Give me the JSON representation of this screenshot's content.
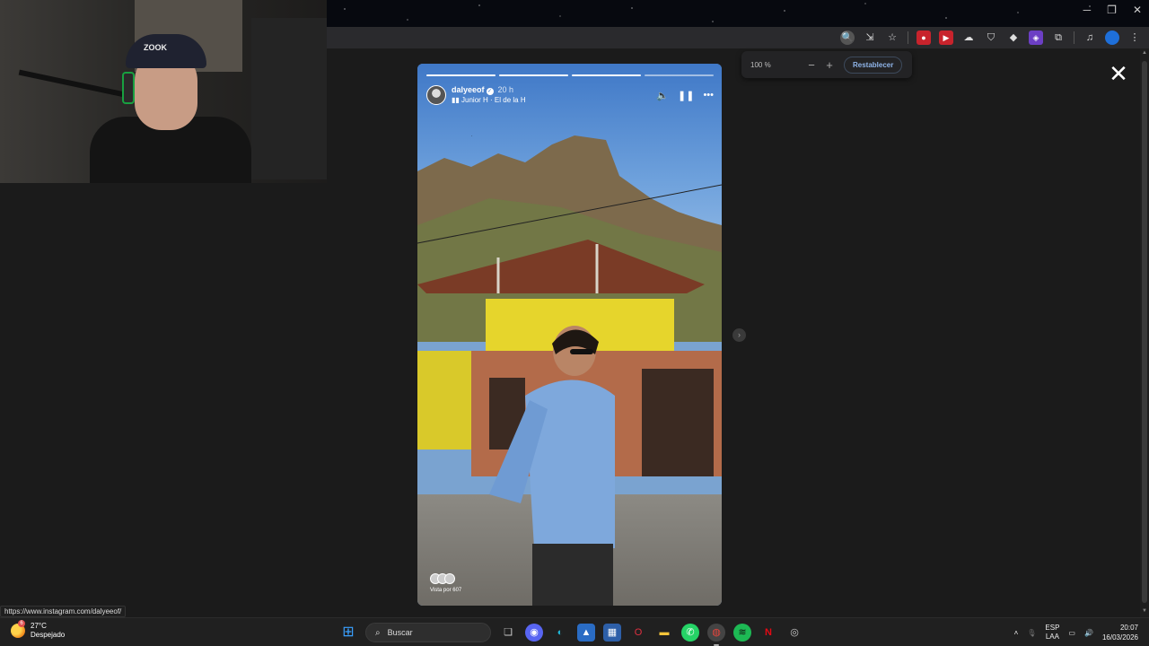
{
  "browser": {
    "zoom": {
      "value": "100 %",
      "minus": "−",
      "plus": "+",
      "reset_label": "Restablecer"
    },
    "status_url": "https://www.instagram.com/dalyeeof/"
  },
  "story": {
    "username": "dalyeeof",
    "time": "20 h",
    "music": "Junior H · El de la H",
    "music_icon": "music-bars-icon",
    "viewers_label": "Vista por 607",
    "progress_segments": 4,
    "progress_done": 3,
    "close_label": "✕",
    "next_label": "›"
  },
  "webcam": {
    "cap_text": "ZOOK"
  },
  "taskbar": {
    "weather_temp": "27°C",
    "weather_desc": "Despejado",
    "weather_badge": "6",
    "search_placeholder": "Buscar",
    "lang_top": "ESP",
    "lang_bottom": "LAA",
    "time": "20:07",
    "date": "16/03/2026"
  },
  "colors": {
    "accent_blue": "#8fb4e8",
    "instagram_bg": "#1b1b1b"
  }
}
